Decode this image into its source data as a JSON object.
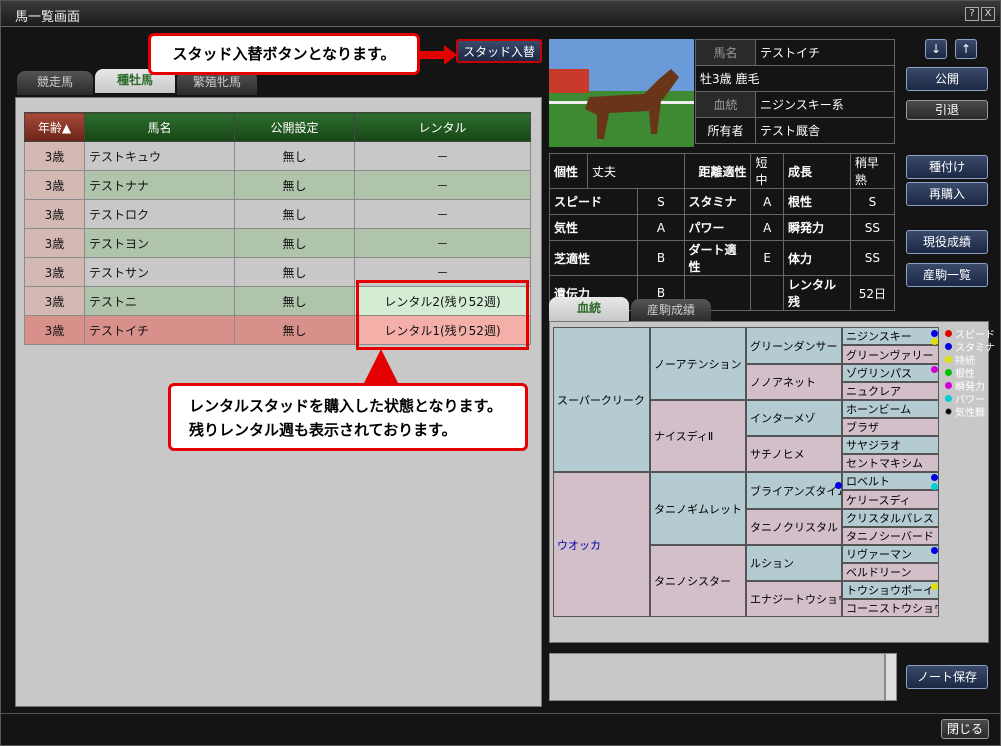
{
  "window": {
    "title": "馬一覧画面",
    "help": "?",
    "close": "X"
  },
  "tabs": [
    "競走馬",
    "種牡馬",
    "繁殖牝馬"
  ],
  "stud_button": "スタッド入替",
  "callout1": "スタッド入替ボタンとなります。",
  "callout2": [
    "レンタルスタッドを購入した状態となります。",
    "残りレンタル週も表示されております。"
  ],
  "table": {
    "headers": [
      "年齢▲",
      "馬名",
      "公開設定",
      "レンタル"
    ],
    "rows": [
      [
        "3歳",
        "テストキュウ",
        "無し",
        "－"
      ],
      [
        "3歳",
        "テストナナ",
        "無し",
        "－"
      ],
      [
        "3歳",
        "テストロク",
        "無し",
        "－"
      ],
      [
        "3歳",
        "テストヨン",
        "無し",
        "－"
      ],
      [
        "3歳",
        "テストサン",
        "無し",
        "－"
      ],
      [
        "3歳",
        "テストニ",
        "無し",
        "レンタル2(残り52週)"
      ],
      [
        "3歳",
        "テストイチ",
        "無し",
        "レンタル1(残り52週)"
      ]
    ]
  },
  "horse": {
    "name_label": "馬名",
    "name": "テストイチ",
    "info": "牡3歳 鹿毛",
    "line_label": "血統",
    "line": "ニジンスキー系",
    "owner_label": "所有者",
    "owner": "テスト厩舎"
  },
  "stats": {
    "r1": [
      "個性",
      "丈夫",
      "距離適性",
      "短中",
      "成長",
      "稍早熟"
    ],
    "r2": [
      "スピード",
      "S",
      "スタミナ",
      "A",
      "根性",
      "S"
    ],
    "r3": [
      "気性",
      "A",
      "パワー",
      "A",
      "瞬発力",
      "SS"
    ],
    "r4": [
      "芝適性",
      "B",
      "ダート適性",
      "E",
      "体力",
      "SS"
    ],
    "r5": [
      "遺伝力",
      "B",
      "",
      "",
      "レンタル残",
      "52日"
    ]
  },
  "ped_tabs": [
    "血統",
    "産駒成績"
  ],
  "pedigree": {
    "g1": [
      "スーパークリーク",
      "ウオッカ"
    ],
    "g2": [
      "ノーアテンション",
      "ナイスディⅡ",
      "タニノギムレット",
      "タニノシスター"
    ],
    "g3": [
      "グリーンダンサー",
      "ノノアネット",
      "インターメゾ",
      "サチノヒメ",
      "ブライアンズタイム",
      "タニノクリスタル",
      "ルション",
      "エナジートウショウ"
    ],
    "g4": [
      "ニジンスキー",
      "グリーンヴァリー",
      "ゾヴリンパス",
      "ニュクレア",
      "ホーンビーム",
      "ブラザ",
      "サヤジラオ",
      "セントマキシム",
      "ロベルト",
      "ケリースディ",
      "クリスタルパレス",
      "タニノシーバード",
      "リヴァーマン",
      "ベルドリーン",
      "トウショウボーイ",
      "コーニストウショウ"
    ]
  },
  "legend": [
    [
      "スピード",
      "#e00000"
    ],
    [
      "スタミナ",
      "#0000e0"
    ],
    [
      "持続",
      "#e0e000"
    ],
    [
      "根性",
      "#00c000"
    ],
    [
      "瞬発力",
      "#d000d0"
    ],
    [
      "パワー",
      "#00d0d0"
    ],
    [
      "気性難",
      "#000000"
    ]
  ],
  "buttons": {
    "up": "↓",
    "down": "↑",
    "public": "公開",
    "retire": "引退",
    "breed": "種付け",
    "rebuy": "再購入",
    "results": "現役成績",
    "offspring": "産駒一覧",
    "note_save": "ノート保存",
    "close": "閉じる"
  }
}
